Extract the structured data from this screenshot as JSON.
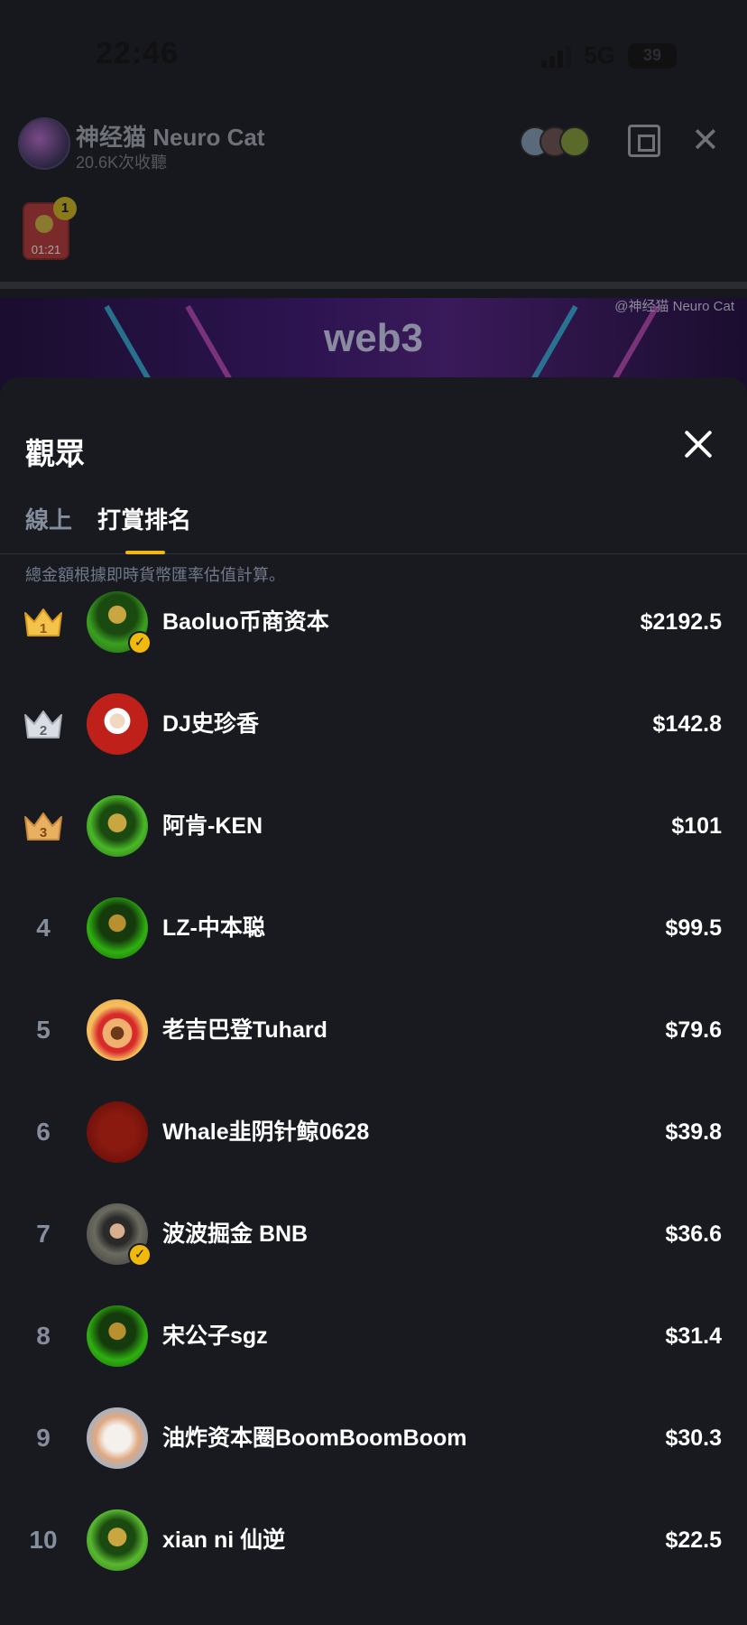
{
  "status_bar": {
    "time": "22:46",
    "network": "5G",
    "battery": "39"
  },
  "stream": {
    "host_name": "神经猫 Neuro Cat",
    "host_meta": "20.6K次收聽",
    "gift_timer": "01:21",
    "gift_badge": "1",
    "banner_title": "web3",
    "watermark": "@神经猫 Neuro Cat"
  },
  "sheet": {
    "title": "觀眾",
    "tabs": [
      {
        "label": "線上"
      },
      {
        "label": "打賞排名"
      }
    ],
    "active_tab": "打賞排名",
    "note": "總金額根據即時貨幣匯率估值計算。"
  },
  "ranking": [
    {
      "rank": "1",
      "name": "Baoluo币商资本",
      "amount": "$2192.5",
      "crown": "gold",
      "verified": true
    },
    {
      "rank": "2",
      "name": "DJ史珍香",
      "amount": "$142.8",
      "crown": "silver",
      "verified": false
    },
    {
      "rank": "3",
      "name": "阿肯-KEN",
      "amount": "$101",
      "crown": "bronze",
      "verified": false
    },
    {
      "rank": "4",
      "name": "LZ-中本聪",
      "amount": "$99.5",
      "verified": false
    },
    {
      "rank": "5",
      "name": "老吉巴登Tuhard",
      "amount": "$79.6",
      "verified": false
    },
    {
      "rank": "6",
      "name": "Whale韭阴针鲸0628",
      "amount": "$39.8",
      "verified": false
    },
    {
      "rank": "7",
      "name": "波波掘金 BNB",
      "amount": "$36.6",
      "verified": true
    },
    {
      "rank": "8",
      "name": "宋公子sgz",
      "amount": "$31.4",
      "verified": false
    },
    {
      "rank": "9",
      "name": "油炸资本圈BoomBoomBoom",
      "amount": "$30.3",
      "verified": false
    },
    {
      "rank": "10",
      "name": "xian ni 仙逆",
      "amount": "$22.5",
      "verified": false
    }
  ],
  "colors": {
    "accent": "#f0b90b",
    "sheet_bg": "#181a20",
    "muted_text": "#848e9c",
    "crown_gold": "#f5c34b",
    "crown_silver": "#d9dde4",
    "crown_bronze": "#e8b060"
  }
}
